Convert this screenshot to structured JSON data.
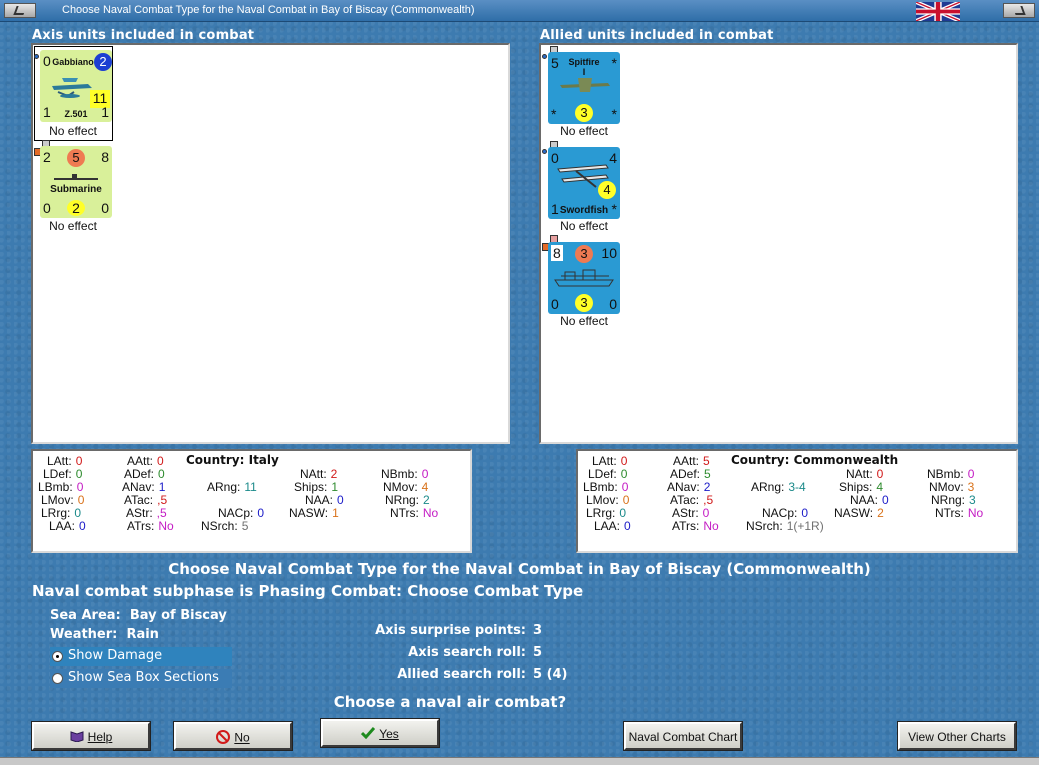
{
  "window": {
    "title": "Choose Naval Combat Type for the Naval Combat in Bay of Biscay (Commonwealth)"
  },
  "axis_panel": {
    "label": "Axis units included in combat",
    "units": [
      {
        "name": "Gabbiano",
        "model": "Z.501",
        "tl": "0",
        "circle": "2",
        "box": "11",
        "bl": "1",
        "br": "1",
        "status": "No effect"
      },
      {
        "name": "Submarine",
        "tl": "2",
        "circle": "5",
        "tr": "8",
        "bl": "0",
        "bc": "2",
        "br": "0",
        "status": "No effect"
      }
    ]
  },
  "allied_panel": {
    "label": "Allied units included in combat",
    "units": [
      {
        "name": "Spitfire",
        "model": "I",
        "tl": "5",
        "tr": "*",
        "bl": "*",
        "bc": "3",
        "br": "*",
        "status": "No effect"
      },
      {
        "name": "Swordfish",
        "tl": "0",
        "tr": "4",
        "circle": "4",
        "bl": "1",
        "br": "*",
        "status": "No effect"
      },
      {
        "name": "",
        "tl": "8",
        "circle": "3",
        "tr": "10",
        "bl": "0",
        "bc": "3",
        "br": "0",
        "status": "No effect"
      }
    ]
  },
  "axis_stats": {
    "country_label": "Country:",
    "country": "Italy",
    "col1": [
      [
        "LAtt:",
        "0"
      ],
      [
        "LDef:",
        "0"
      ],
      [
        "LBmb:",
        "0"
      ],
      [
        "LMov:",
        "0"
      ],
      [
        "LRrg:",
        "0"
      ],
      [
        "LAA:",
        "0"
      ]
    ],
    "col2": [
      [
        "AAtt:",
        "0"
      ],
      [
        "ADef:",
        "0"
      ],
      [
        "ANav:",
        "1"
      ],
      [
        "ATac:",
        ",5"
      ],
      [
        "AStr:",
        ",5"
      ],
      [
        "ATrs:",
        "No"
      ]
    ],
    "arng": [
      "ARng:",
      "11"
    ],
    "nacp": [
      "NACp:",
      "0"
    ],
    "nsrch": [
      "NSrch:",
      "5"
    ],
    "col4": [
      [
        "NAtt:",
        "2"
      ],
      [
        "Ships:",
        "1"
      ],
      [
        "NAA:",
        "0"
      ],
      [
        "NASW:",
        "1"
      ]
    ],
    "col5": [
      [
        "NBmb:",
        "0"
      ],
      [
        "NMov:",
        "4"
      ],
      [
        "NRng:",
        "2"
      ],
      [
        "NTrs:",
        "No"
      ]
    ]
  },
  "allied_stats": {
    "country_label": "Country:",
    "country": "Commonwealth",
    "col1": [
      [
        "LAtt:",
        "0"
      ],
      [
        "LDef:",
        "0"
      ],
      [
        "LBmb:",
        "0"
      ],
      [
        "LMov:",
        "0"
      ],
      [
        "LRrg:",
        "0"
      ],
      [
        "LAA:",
        "0"
      ]
    ],
    "col2": [
      [
        "AAtt:",
        "5"
      ],
      [
        "ADef:",
        "5"
      ],
      [
        "ANav:",
        "2"
      ],
      [
        "ATac:",
        ",5"
      ],
      [
        "AStr:",
        "0"
      ],
      [
        "ATrs:",
        "No"
      ]
    ],
    "arng": [
      "ARng:",
      "3-4"
    ],
    "nacp": [
      "NACp:",
      "0"
    ],
    "nsrch": [
      "NSrch:",
      "1(+1R)"
    ],
    "col4": [
      [
        "NAtt:",
        "0"
      ],
      [
        "Ships:",
        "4"
      ],
      [
        "NAA:",
        "0"
      ],
      [
        "NASW:",
        "2"
      ]
    ],
    "col5": [
      [
        "NBmb:",
        "0"
      ],
      [
        "NMov:",
        "3"
      ],
      [
        "NRng:",
        "3"
      ],
      [
        "NTrs:",
        "No"
      ]
    ]
  },
  "messages": {
    "heading": "Choose Naval Combat Type for the Naval Combat in Bay of Biscay (Commonwealth)",
    "subphase": "Naval combat subphase is Phasing Combat: Choose Combat Type",
    "sea_area_label": "Sea Area:",
    "sea_area": "Bay of Biscay",
    "weather_label": "Weather:",
    "weather": "Rain",
    "surprise_label": "Axis surprise points:",
    "surprise": "3",
    "axis_search_label": "Axis search roll:",
    "axis_search": "5",
    "allied_search_label": "Allied search roll:",
    "allied_search": "5 (4)",
    "question": "Choose a naval air combat?"
  },
  "options": {
    "show_damage": "Show Damage",
    "show_sea_box": "Show Sea Box Sections"
  },
  "buttons": {
    "help": "Help",
    "no": "No",
    "yes": "Yes",
    "naval_chart": "Naval Combat Chart",
    "other_charts": "View Other Charts"
  },
  "colors": {
    "axis_counter": "#d9f09a",
    "allied_counter": "#2a9ad3",
    "red_value": "#d11a1a",
    "green_value": "#2e8b2e",
    "magenta_value": "#c41cc4",
    "blue_value": "#1c1cc8",
    "orange_value": "#d9721a",
    "teal_value": "#1b8a8a",
    "gray_value": "#707070"
  }
}
